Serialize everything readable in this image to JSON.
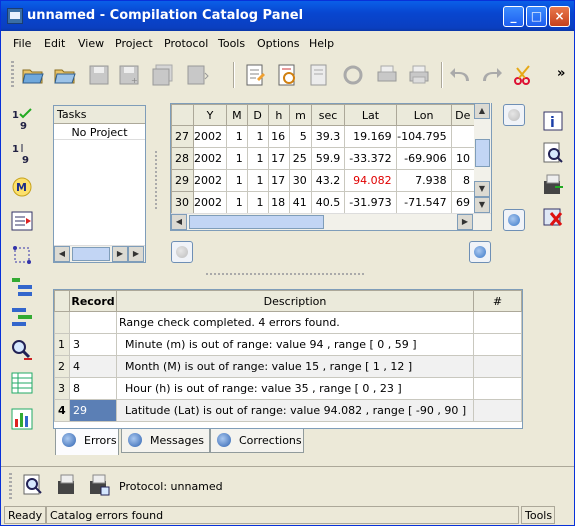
{
  "window": {
    "title": "unnamed  - Compilation Catalog Panel"
  },
  "title_buttons": {
    "minimize": "_",
    "maximize": "□",
    "close": "×"
  },
  "menu": [
    "File",
    "Edit",
    "View",
    "Project",
    "Protocol",
    "Tools",
    "Options",
    "Help"
  ],
  "toolbar": {
    "overflow": "»"
  },
  "tasks": {
    "header": "Tasks",
    "items": [
      "No Project"
    ]
  },
  "grid": {
    "columns": [
      "",
      "Y",
      "M",
      "D",
      "h",
      "m",
      "sec",
      "Lat",
      "Lon",
      "De"
    ],
    "rows": [
      {
        "n": "27",
        "Y": "2002",
        "M": "1",
        "D": "1",
        "h": "16",
        "m": "5",
        "sec": "39.3",
        "Lat": "19.169",
        "Lon": "-104.795",
        "De": ""
      },
      {
        "n": "28",
        "Y": "2002",
        "M": "1",
        "D": "1",
        "h": "17",
        "m": "25",
        "sec": "59.9",
        "Lat": "-33.372",
        "Lon": "-69.906",
        "De": "10"
      },
      {
        "n": "29",
        "Y": "2002",
        "M": "1",
        "D": "1",
        "h": "17",
        "m": "30",
        "sec": "43.2",
        "Lat": "94.082",
        "Lon": "7.938",
        "De": "8"
      },
      {
        "n": "30",
        "Y": "2002",
        "M": "1",
        "D": "1",
        "h": "18",
        "m": "41",
        "sec": "40.5",
        "Lat": "-31.973",
        "Lon": "-71.547",
        "De": "69"
      }
    ],
    "highlight_color": "#e00000"
  },
  "errors": {
    "columns": [
      "",
      "Record",
      "Description",
      "#"
    ],
    "summary": "Range check completed. 4 errors found.",
    "rows": [
      {
        "n": "1",
        "record": "3",
        "desc": "Minute (m) is out of range: value 94 , range [ 0 , 59 ]"
      },
      {
        "n": "2",
        "record": "4",
        "desc": "Month (M) is out of range: value 15 , range [ 1 , 12 ]"
      },
      {
        "n": "3",
        "record": "8",
        "desc": "Hour (h) is out of range: value 35 , range [ 0 , 23 ]"
      },
      {
        "n": "4",
        "record": "29",
        "desc": "Latitude (Lat) is out of range: value 94.082 , range [ -90 , 90 ]"
      }
    ],
    "selected_color": "#5b7fb5"
  },
  "tabs": [
    "Errors",
    "Messages",
    "Corrections"
  ],
  "bottom": {
    "protocol": "Protocol: unnamed"
  },
  "status": {
    "state": "Ready",
    "message": "Catalog errors found",
    "tools": "Tools"
  }
}
